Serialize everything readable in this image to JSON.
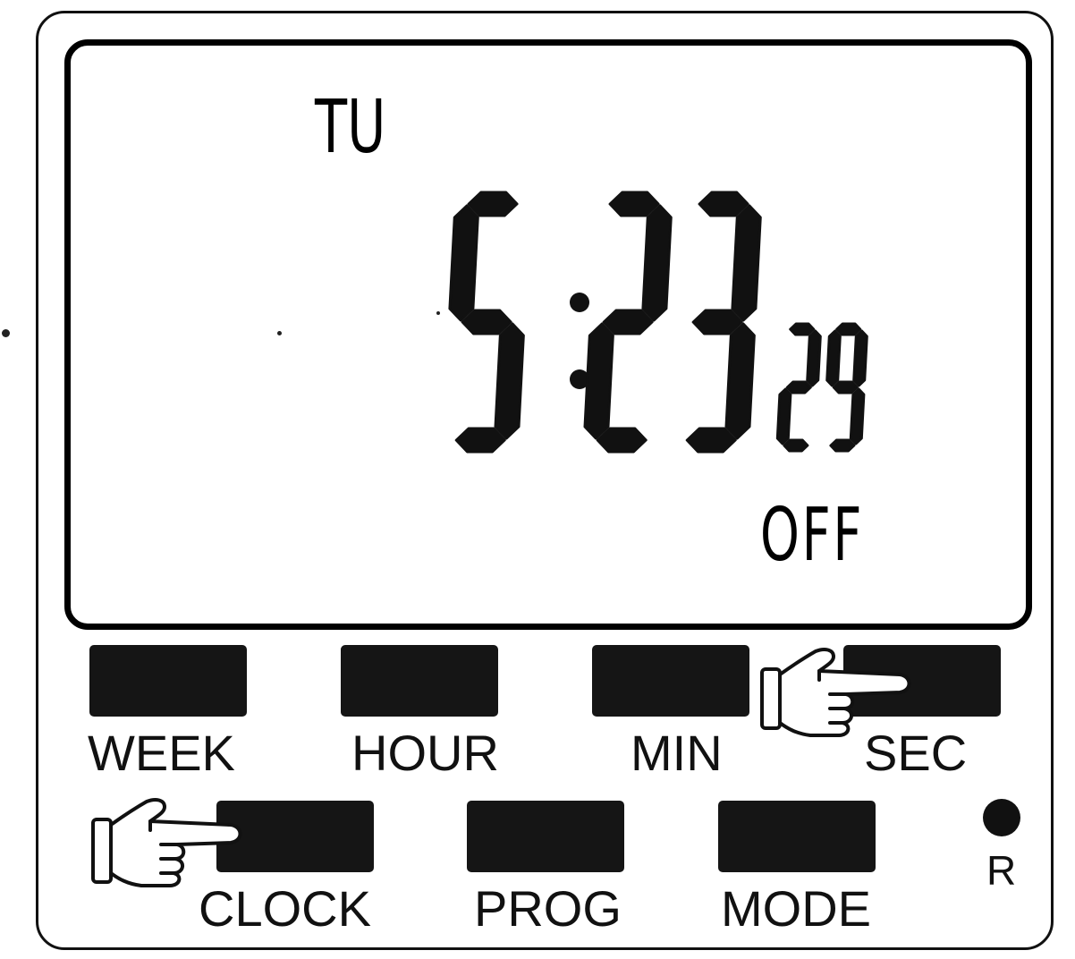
{
  "display": {
    "day": "TU",
    "hours": "5",
    "minutes": "23",
    "seconds": "29",
    "status": "OFF"
  },
  "buttons": {
    "week": "WEEK",
    "hour": "HOUR",
    "min": "MIN",
    "sec": "SEC",
    "clock": "CLOCK",
    "prog": "PROG",
    "mode": "MODE",
    "reset": "R"
  },
  "icons": {
    "pointer_sec": "pointing-hand-icon",
    "pointer_clock": "pointing-hand-icon"
  },
  "colors": {
    "ink": "#111111",
    "background": "#ffffff"
  }
}
